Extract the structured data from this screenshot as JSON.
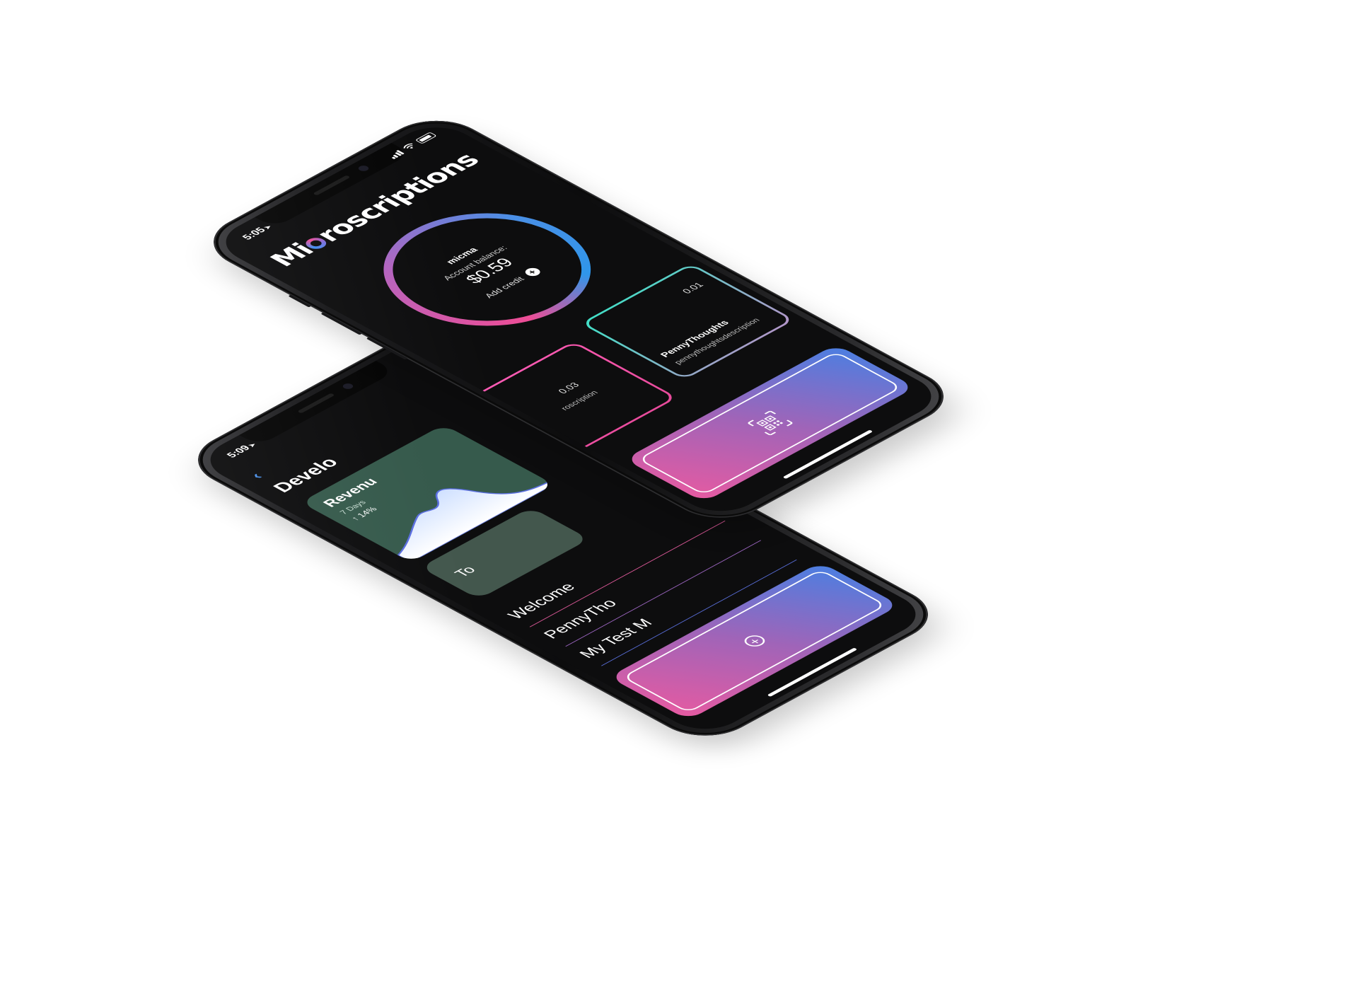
{
  "front_phone": {
    "status_time": "5:05",
    "app_title_start": "Mi",
    "app_title_end": "roscriptions",
    "account": {
      "username": "micma",
      "balance_label": "Account balance:",
      "balance": "$0.59",
      "add_credit": "Add credit"
    },
    "subscriptions": [
      {
        "name": "PennyThoughts",
        "price": "0.01",
        "description": "pennythoughtsdescription"
      },
      {
        "price": "0.03",
        "description": "roscription"
      }
    ],
    "action_icon": "qr-scan-icon"
  },
  "back_phone": {
    "status_time": "5:09",
    "title": "Develo",
    "revenue": {
      "title": "Revenu",
      "range": "7 Days",
      "change": "14%"
    },
    "total_label": "To",
    "list": [
      "Welcome",
      "PennyTho",
      "My Test M"
    ],
    "action_icon": "plus-circle-icon"
  },
  "colors": {
    "pink": "#e75aa1",
    "purple": "#a064b8",
    "blue": "#4a7fe2",
    "teal": "#3fe0c6",
    "revenue_card": "#365a4c"
  }
}
